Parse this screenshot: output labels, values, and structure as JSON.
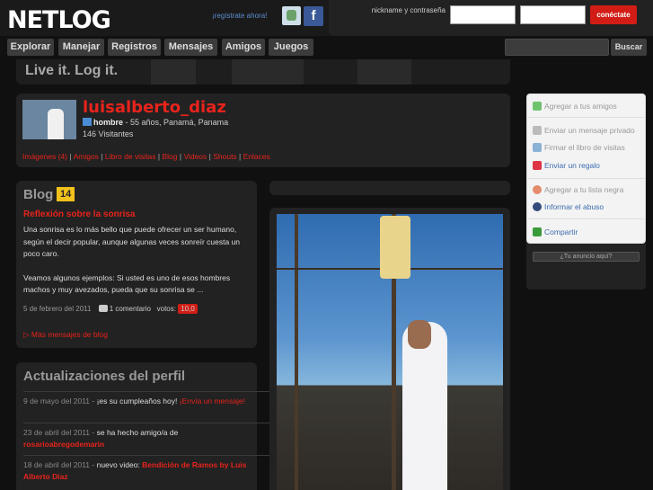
{
  "header": {
    "logo": "NETLOG",
    "register_link": "¡regístrate ahora!",
    "facebook_label": "f",
    "login_label": "nickname y contraseña",
    "nickname_value": "",
    "password_value": "",
    "connect_button": "conéctate"
  },
  "nav": {
    "items": [
      {
        "label": "Explorar"
      },
      {
        "label": "Manejar"
      },
      {
        "label": "Registros"
      },
      {
        "label": "Mensajes"
      },
      {
        "label": "Amigos"
      },
      {
        "label": "Juegos"
      }
    ],
    "search_placeholder": "",
    "search_button": "Buscar"
  },
  "banner": {
    "text": "Live it. Log it."
  },
  "profile": {
    "username": "luisalberto_diaz",
    "gender": "hombre",
    "details": " - 55 años, Panamá, Panama",
    "visits": "146 Visitantes",
    "links": [
      "Imágenes (4)",
      "Amigos",
      "Libro de visitas",
      "Blog",
      "Videos",
      "Shouts",
      "Enlaces"
    ]
  },
  "blog": {
    "title": "Blog",
    "count": "14",
    "post_title": "Reflexión sobre la sonrisa",
    "post_body_1": "Una sonrisa es lo más bello que puede ofrecer un ser humano, según el decir popular, aunque algunas veces sonreír cuesta un poco caro.",
    "post_body_2": "Veamos algunos ejemplos: Si usted es uno de esos hombres machos y muy avezados, pueda que su sonrisa se ...",
    "date": "5 de febrero del 2011",
    "comments": "1 comentario",
    "votes_label": "votos:",
    "votes_value": "10,0",
    "more": "Más mensajes de blog"
  },
  "updates": {
    "title": "Actualizaciones del perfil",
    "items": [
      {
        "date": "9 de mayo del 2011",
        "text": " · ¡es su cumpleaños hoy! ",
        "link": "¡Envía un mensaje!"
      },
      {
        "date": "23 de abril del 2011",
        "text": " · se ha hecho amigo/a de ",
        "link": "rosarioabregodemarin"
      },
      {
        "date": "18 de abril del 2011",
        "text": " · nuevo video: ",
        "link": "Bendición de Ramos by Luis Alberto Diaz"
      }
    ]
  },
  "sidebar": {
    "add_friends": "Agregar a tus amigos",
    "private_message": "Enviar un mensaje privado",
    "sign_guestbook": "Firmar el libro de visitas",
    "send_gift": "Enviar un regalo",
    "blacklist": "Agregar a tu lista negra",
    "report": "Informar el abuso",
    "share": "Compartir",
    "ad_label": "¿Tu anuncio aquí?"
  },
  "colors": {
    "accent": "#e8231c",
    "link_blue": "#3b6cb0",
    "badge": "#f2c21c"
  }
}
